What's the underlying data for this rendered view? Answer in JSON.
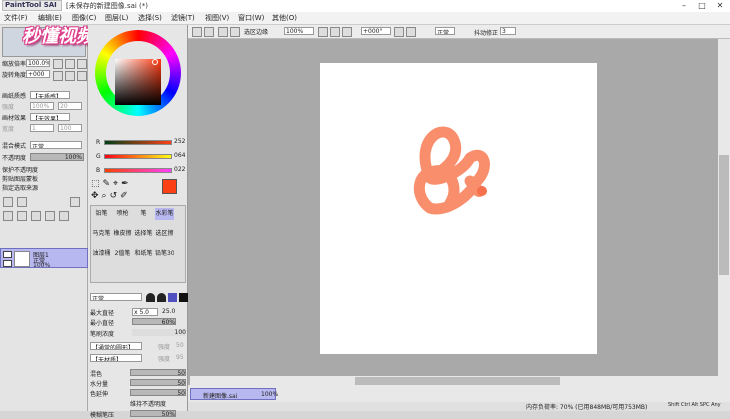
{
  "window": {
    "app_logo": "PaintTool SAI",
    "title": "[未保存的新建图像.sai (*)"
  },
  "menu": [
    "文件(F)",
    "编辑(E)",
    "图像(C)",
    "图层(L)",
    "选择(S)",
    "滤镜(T)",
    "视图(V)",
    "窗口(W)",
    "其他(O)"
  ],
  "watermark": "秒懂视频",
  "nav": {
    "zoom_label": "缩放倍率",
    "zoom_value": "100.0%",
    "angle_label": "旋转角度",
    "angle_value": "+000"
  },
  "layer_props": {
    "paper_tex_label": "画纸质感",
    "paper_tex_value": "【无质感】",
    "scale_label": "强度",
    "scale_value": "100%",
    "strength_value": "20",
    "effect_label": "画材效果",
    "effect_value": "【无效果】",
    "width_label": "宽度",
    "width_value": "1",
    "strength2": "100",
    "blend_label": "混合模式",
    "blend_value": "正常",
    "opacity_label": "不透明度",
    "opacity_value": "100%",
    "chk1": "保护不透明度",
    "chk2": "剪贴图层蒙板",
    "chk3": "指定选取来源"
  },
  "layer": {
    "name": "图层1",
    "mode": "正常",
    "opacity": "100%"
  },
  "rgb": {
    "r_label": "R",
    "r_value": "252",
    "g_label": "G",
    "g_value": "064",
    "b_label": "B",
    "b_value": "022"
  },
  "tools": {
    "pencil": "铅笔",
    "airbrush": "喷枪",
    "brush": "笔",
    "watercolor": "水彩笔",
    "marker": "马克笔",
    "eraser": "橡皮擦",
    "select_pen": "选择笔",
    "deselect": "选区擦",
    "bucket": "油漆桶",
    "binary": "2值笔",
    "brush2": "和纸笔",
    "pen30": "铅笔30"
  },
  "brush": {
    "mode_value": "正常",
    "max_label": "最大直径",
    "max_mult": "x 5.0",
    "max_value": "25.0",
    "min_label": "最小直径",
    "min_value": "60%",
    "density_label": "笔刷浓度",
    "density_value": "100",
    "shape_value": "【通常的圆形】",
    "shape_strength": "强度",
    "shape_num": "50",
    "tex_value": "【无材质】",
    "tex_strength": "强度",
    "tex_num": "95",
    "blend_label": "混色",
    "blend_value": "50",
    "water_label": "水分量",
    "water_value": "50",
    "persist_label": "色延伸",
    "persist_value": "50",
    "keep_opacity": "维持不透明度",
    "blur_label": "模糊笔压",
    "blur_value": "50%"
  },
  "toolbar": {
    "sel_edge": "选区边缘",
    "zoom": "100%",
    "rotation": "+000°",
    "mode": "正常",
    "stab_label": "抖动修正",
    "stab_value": "3"
  },
  "taskbar": {
    "doc": "新建图像.sai",
    "pct": "100%"
  },
  "status": {
    "mem": "内存负荷率: 70% (已用848MB/可用753MB)",
    "keys": "Shift Ctrl Alt SPC Any"
  },
  "colors": {
    "fg": "#fc4016",
    "accent": "#fc4016",
    "stroke": "#f7825c"
  }
}
